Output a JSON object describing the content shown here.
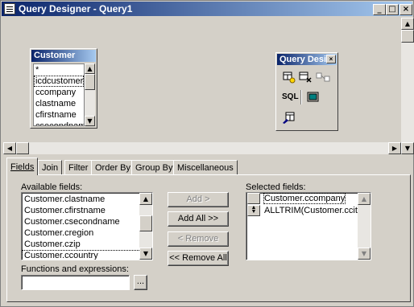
{
  "window": {
    "title": "Query Designer - Query1",
    "controls": {
      "minimize": "_",
      "maximize": "□",
      "close": "×"
    }
  },
  "table_window": {
    "title": "Customer",
    "fields": [
      "*",
      "icdcustomer",
      "ccompany",
      "clastname",
      "cfirstname",
      "csecondname"
    ],
    "selected_index": 1
  },
  "query_toolbar": {
    "title": "Query Desi",
    "close": "×",
    "tools": [
      "add-table-icon",
      "remove-table-icon",
      "join-icon",
      "sql-icon",
      "output-icon",
      "query-destination-icon"
    ],
    "sql_label": "SQL"
  },
  "tabs": [
    "Fields",
    "Join",
    "Filter",
    "Order By",
    "Group By",
    "Miscellaneous"
  ],
  "active_tab": 0,
  "fields_tab": {
    "available_label": "Available fields:",
    "available_fields": [
      "Customer.clastname",
      "Customer.cfirstname",
      "Customer.csecondname",
      "Customer.cregion",
      "Customer.czip",
      "Customer.ccountry"
    ],
    "selected_label": "Selected fields:",
    "selected_fields": [
      "Customer.ccompany",
      "ALLTRIM(Customer.ccity)+"
    ],
    "functions_label": "Functions and expressions:",
    "functions_value": "",
    "ellipsis": "...",
    "buttons": {
      "add": "Add >",
      "add_all": "Add All >>",
      "remove": "< Remove",
      "remove_all": "<< Remove All"
    }
  }
}
